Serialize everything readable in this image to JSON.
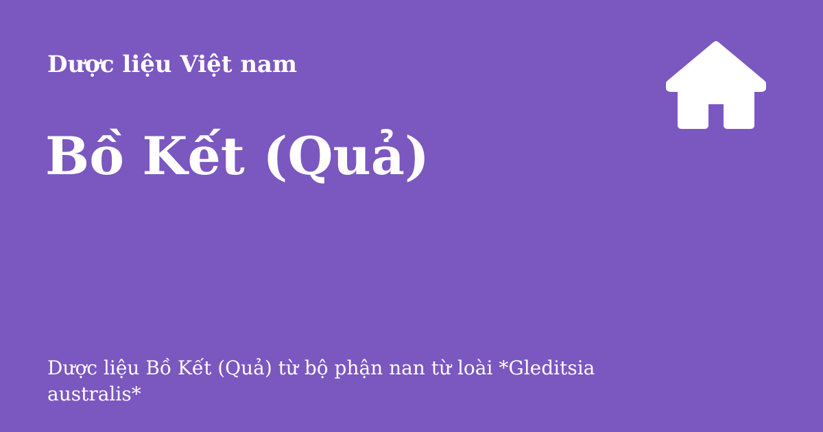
{
  "site": {
    "name": "Dược liệu Việt nam"
  },
  "page": {
    "title": "Bồ Kết (Quả)",
    "description": "Dược liệu Bồ Kết (Quả) từ bộ phận nan từ loài *Gleditsia australis*"
  },
  "icons": {
    "home": "home-icon"
  },
  "colors": {
    "background": "#7b57c0",
    "text": "#ffffff"
  }
}
